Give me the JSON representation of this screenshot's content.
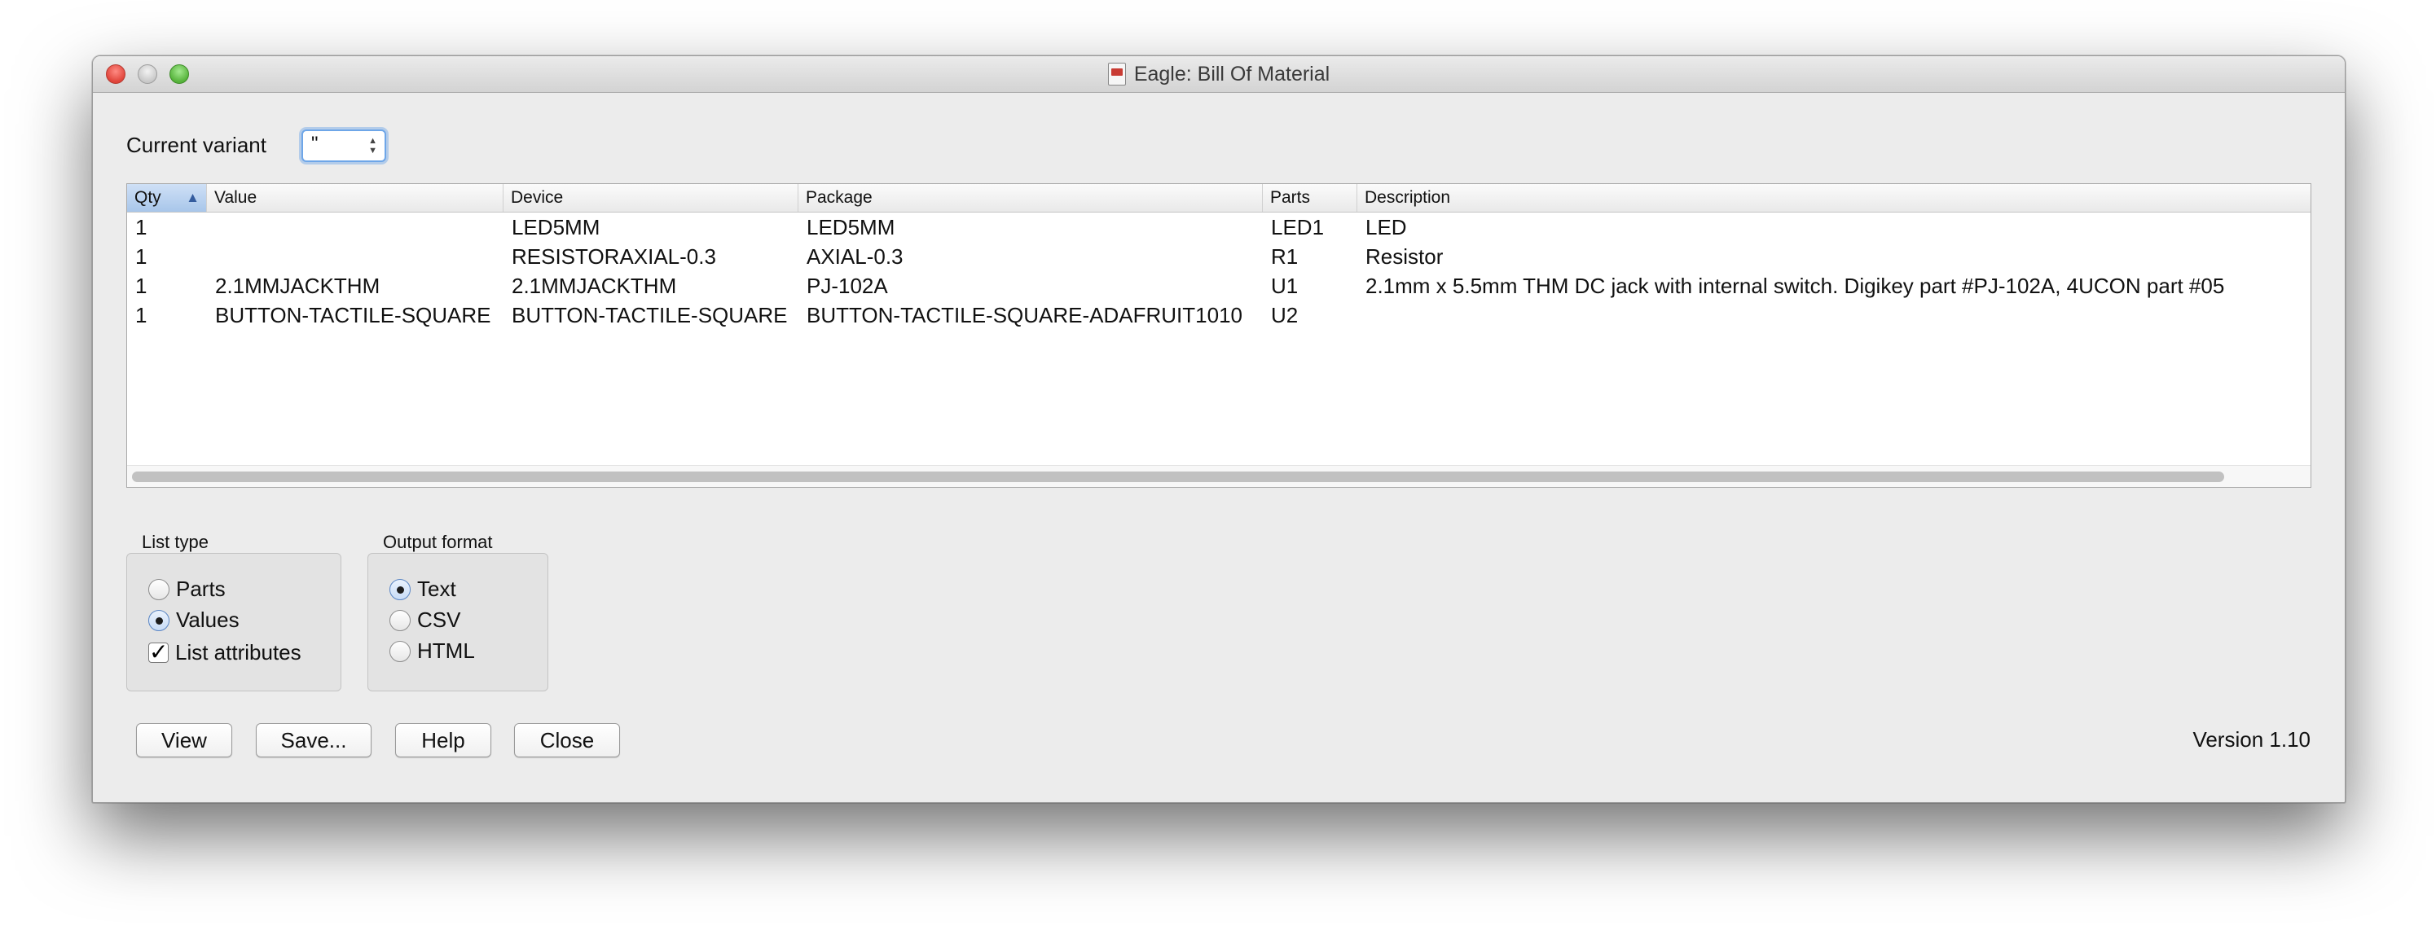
{
  "window": {
    "title": "Eagle: Bill Of Material"
  },
  "variant": {
    "label": "Current variant",
    "value": "\""
  },
  "table": {
    "columns": [
      "Qty",
      "Value",
      "Device",
      "Package",
      "Parts",
      "Description"
    ],
    "rows": [
      [
        "1",
        "",
        "LED5MM",
        "LED5MM",
        "LED1",
        "LED"
      ],
      [
        "1",
        "",
        "RESISTORAXIAL-0.3",
        "AXIAL-0.3",
        "R1",
        "Resistor"
      ],
      [
        "1",
        "2.1MMJACKTHM",
        "2.1MMJACKTHM",
        "PJ-102A",
        "U1",
        "2.1mm x 5.5mm THM DC jack with internal switch. Digikey part #PJ-102A, 4UCON part #05"
      ],
      [
        "1",
        "BUTTON-TACTILE-SQUARE",
        "BUTTON-TACTILE-SQUARE",
        "BUTTON-TACTILE-SQUARE-ADAFRUIT1010",
        "U2",
        ""
      ]
    ]
  },
  "list_type": {
    "label": "List type",
    "options": [
      {
        "label": "Parts",
        "selected": false
      },
      {
        "label": "Values",
        "selected": true
      }
    ],
    "attributes": {
      "label": "List attributes",
      "checked": true
    }
  },
  "output_format": {
    "label": "Output format",
    "options": [
      {
        "label": "Text",
        "selected": true
      },
      {
        "label": "CSV",
        "selected": false
      },
      {
        "label": "HTML",
        "selected": false
      }
    ]
  },
  "buttons": {
    "view": "View",
    "save": "Save...",
    "help": "Help",
    "close": "Close"
  },
  "version": "Version 1.10"
}
